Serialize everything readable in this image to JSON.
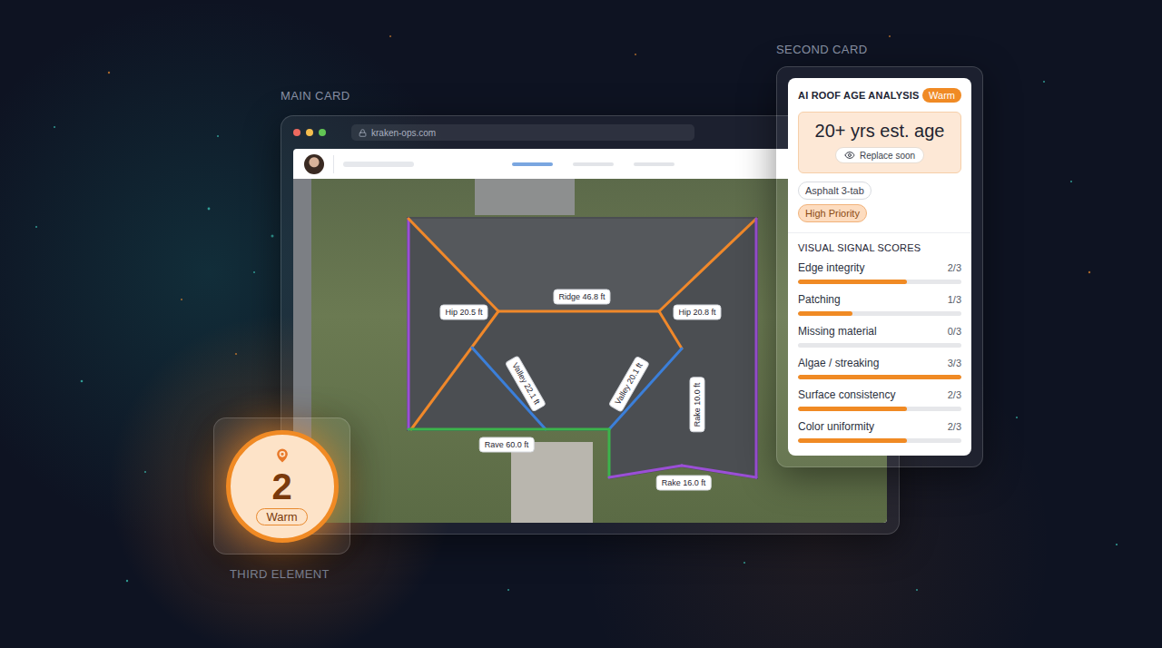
{
  "labels": {
    "main_card": "MAIN CARD",
    "second_card": "SECOND CARD",
    "third_element": "THIRD ELEMENT"
  },
  "browser": {
    "url": "kraken-ops.com",
    "header_tabs": [
      {
        "selected": true
      },
      {
        "selected": false
      },
      {
        "selected": false
      }
    ]
  },
  "map": {
    "measurements": [
      {
        "label": "Hip 20.5 ft",
        "kind": "hip",
        "color": "#f0882a"
      },
      {
        "label": "Ridge 46.8 ft",
        "kind": "ridge",
        "color": "#f0882a"
      },
      {
        "label": "Hip 20.8 ft",
        "kind": "hip",
        "color": "#f0882a"
      },
      {
        "label": "Valley 22.1 ft",
        "kind": "valley",
        "color": "#3b7fd9"
      },
      {
        "label": "Valley 20.1 ft",
        "kind": "valley",
        "color": "#3b7fd9"
      },
      {
        "label": "Rake 10.0 ft",
        "kind": "rake",
        "color": "#9b4fd6"
      },
      {
        "label": "Rave 60.0 ft",
        "kind": "eave",
        "color": "#3cb44b"
      },
      {
        "label": "Rake 16.0 ft",
        "kind": "rake",
        "color": "#9b4fd6"
      }
    ]
  },
  "analysis": {
    "title": "AI ROOF AGE ANALYSIS",
    "badge": "Warm",
    "age": "20+ yrs est. age",
    "advice": "Replace soon",
    "tags": [
      {
        "label": "Asphalt 3-tab",
        "kind": "neutral"
      },
      {
        "label": "High Priority",
        "kind": "priority"
      }
    ],
    "scores_title": "VISUAL SIGNAL SCORES",
    "scores": [
      {
        "name": "Edge integrity",
        "reading": "2/3",
        "level": 0.667
      },
      {
        "name": "Patching",
        "reading": "1/3",
        "level": 0.333
      },
      {
        "name": "Missing material",
        "reading": "0/3",
        "level": 0
      },
      {
        "name": "Algae / streaking",
        "reading": "3/3",
        "level": 1
      },
      {
        "name": "Surface consistency",
        "reading": "2/3",
        "level": 0.667
      },
      {
        "name": "Color uniformity",
        "reading": "2/3",
        "level": 0.667
      }
    ]
  },
  "pin": {
    "count": "2",
    "badge": "Warm"
  }
}
